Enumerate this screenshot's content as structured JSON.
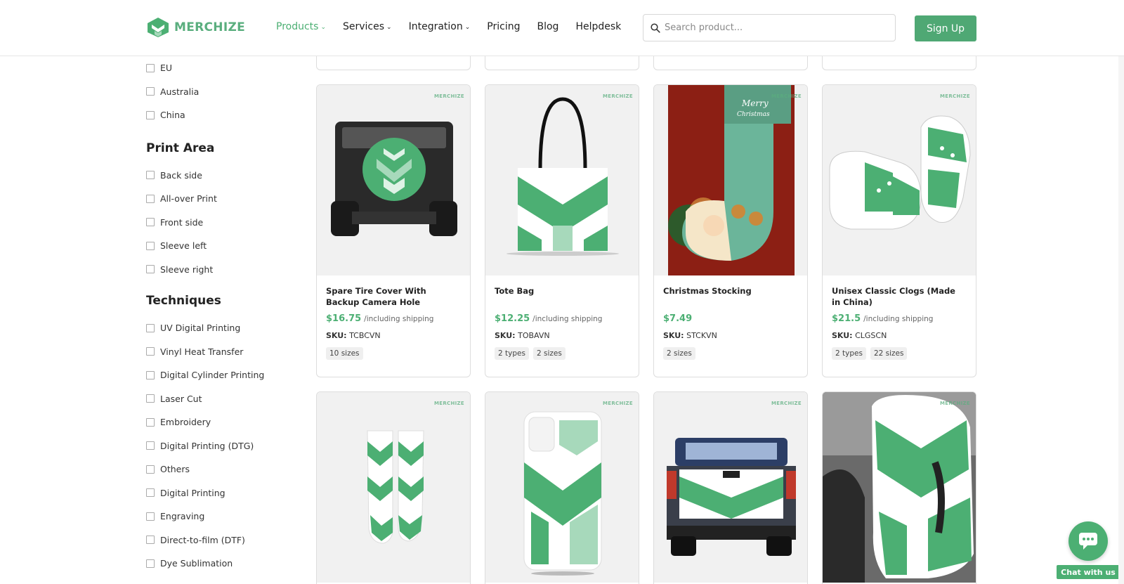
{
  "header": {
    "logo_text": "MERCHIZE",
    "nav": [
      {
        "label": "Products",
        "has_chevron": true,
        "active": true
      },
      {
        "label": "Services",
        "has_chevron": true,
        "active": false
      },
      {
        "label": "Integration",
        "has_chevron": true,
        "active": false
      },
      {
        "label": "Pricing",
        "has_chevron": false,
        "active": false
      },
      {
        "label": "Blog",
        "has_chevron": false,
        "active": false
      },
      {
        "label": "Helpdesk",
        "has_chevron": false,
        "active": false
      }
    ],
    "search_placeholder": "Search product...",
    "signup_label": "Sign Up"
  },
  "sidebar": {
    "location_items": [
      "EU",
      "Australia",
      "China"
    ],
    "print_area": {
      "title": "Print Area",
      "items": [
        "Back side",
        "All-over Print",
        "Front side",
        "Sleeve left",
        "Sleeve right"
      ]
    },
    "techniques": {
      "title": "Techniques",
      "items": [
        "UV Digital Printing",
        "Vinyl Heat Transfer",
        "Digital Cylinder Printing",
        "Laser Cut",
        "Embroidery",
        "Digital Printing (DTG)",
        "Others",
        "Digital Printing",
        "Engraving",
        "Direct-to-film (DTF)",
        "Dye Sublimation"
      ]
    }
  },
  "products": [
    {
      "title": "Spare Tire Cover With Backup Camera Hole",
      "price": "$16.75",
      "shipping": "/including shipping",
      "sku_label": "SKU:",
      "sku": "TCBCVN",
      "tags": [
        "10 sizes"
      ],
      "image": "spare-tire-cover-image"
    },
    {
      "title": "Tote Bag",
      "price": "$12.25",
      "shipping": "/including shipping",
      "sku_label": "SKU:",
      "sku": "TOBAVN",
      "tags": [
        "2 types",
        "2 sizes"
      ],
      "image": "tote-bag-image"
    },
    {
      "title": "Christmas Stocking",
      "price": "$7.49",
      "shipping": "",
      "sku_label": "SKU:",
      "sku": "STCKVN",
      "tags": [
        "2 sizes"
      ],
      "image": "christmas-stocking-image"
    },
    {
      "title": "Unisex Classic Clogs (Made in China)",
      "price": "$21.5",
      "shipping": "/including shipping",
      "sku_label": "SKU:",
      "sku": "CLGSCN",
      "tags": [
        "2 types",
        "22 sizes"
      ],
      "image": "clogs-image"
    }
  ],
  "next_row_images": [
    "socks-image",
    "phone-case-image",
    "truck-tailgate-image",
    "car-seat-cover-image"
  ],
  "chat": {
    "label": "Chat with us"
  },
  "colors": {
    "brand": "#4caf73",
    "brand_dark": "#4fa874"
  }
}
